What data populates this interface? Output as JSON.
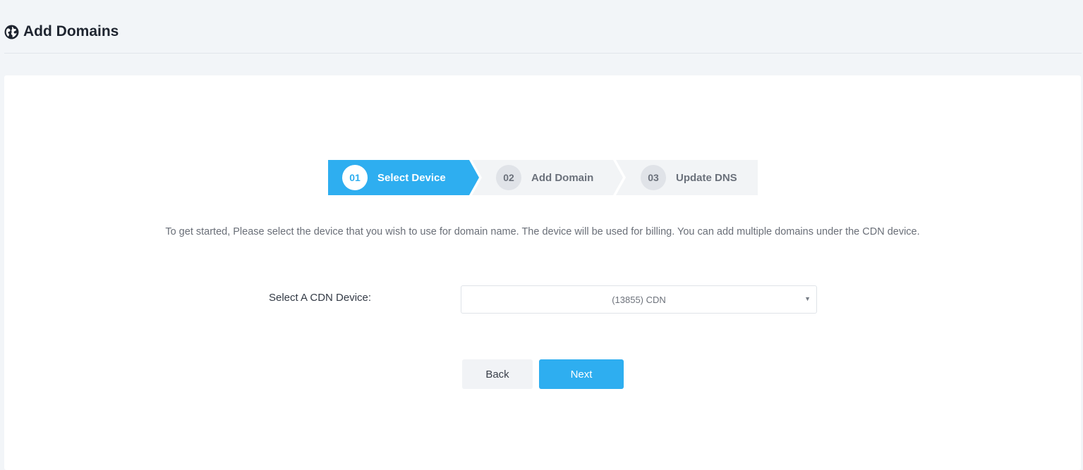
{
  "header": {
    "title": "Add Domains",
    "icon": "globe-icon"
  },
  "stepper": {
    "steps": [
      {
        "number": "01",
        "label": "Select Device",
        "active": true
      },
      {
        "number": "02",
        "label": "Add Domain",
        "active": false
      },
      {
        "number": "03",
        "label": "Update DNS",
        "active": false
      }
    ]
  },
  "intro_text": "To get started, Please select the device that you wish to use for domain name. The device will be used for billing. You can add multiple domains under the CDN device.",
  "device_select": {
    "label": "Select A CDN Device:",
    "value": "(13855) CDN"
  },
  "actions": {
    "back_label": "Back",
    "next_label": "Next"
  },
  "colors": {
    "accent": "#2eaef0",
    "page_background": "#f2f5f8",
    "card_background": "#ffffff"
  }
}
